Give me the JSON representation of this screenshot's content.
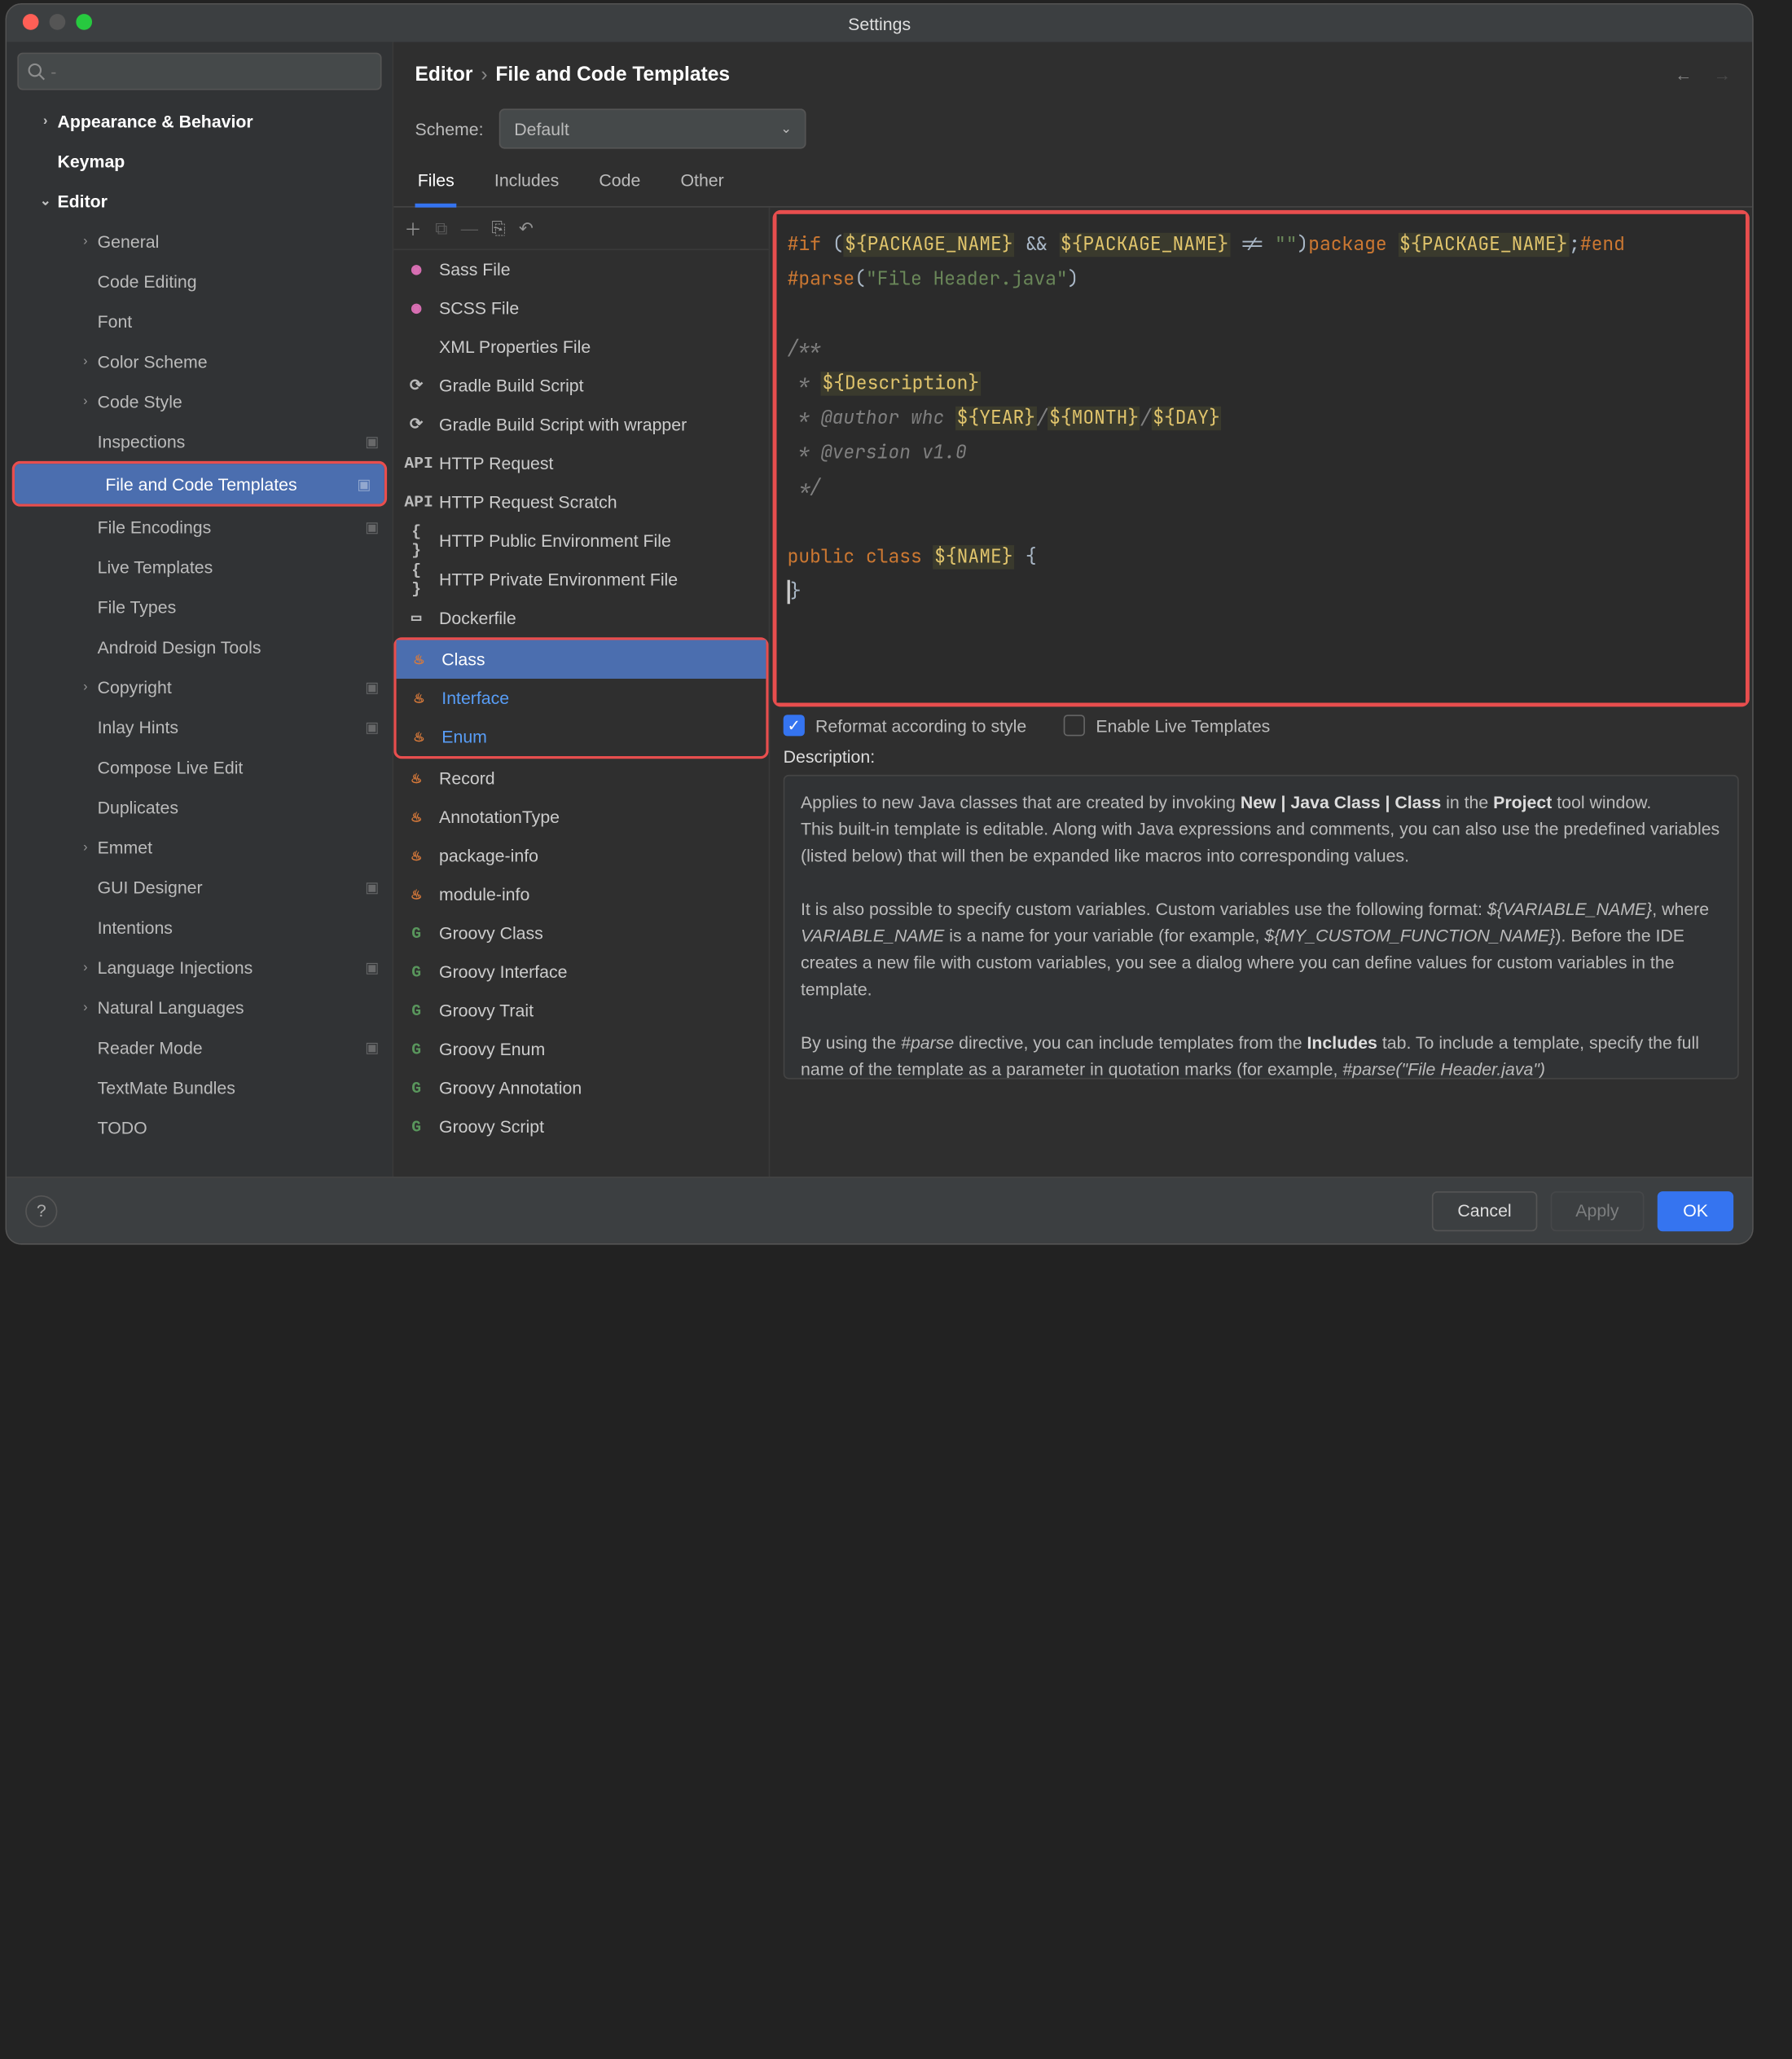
{
  "window_title": "Settings",
  "breadcrumb": {
    "root": "Editor",
    "page": "File and Code Templates"
  },
  "searchPlaceholder": "",
  "sidebar": {
    "appearance": "Appearance & Behavior",
    "keymap": "Keymap",
    "editor": "Editor",
    "items": [
      {
        "label": "General",
        "chev": true
      },
      {
        "label": "Code Editing"
      },
      {
        "label": "Font"
      },
      {
        "label": "Color Scheme",
        "chev": true
      },
      {
        "label": "Code Style",
        "chev": true
      },
      {
        "label": "Inspections",
        "badge": true
      },
      {
        "label": "File and Code Templates",
        "selected": true,
        "badge": true
      },
      {
        "label": "File Encodings",
        "badge": true
      },
      {
        "label": "Live Templates"
      },
      {
        "label": "File Types"
      },
      {
        "label": "Android Design Tools"
      },
      {
        "label": "Copyright",
        "chev": true,
        "badge": true
      },
      {
        "label": "Inlay Hints",
        "badge": true
      },
      {
        "label": "Compose Live Edit"
      },
      {
        "label": "Duplicates"
      },
      {
        "label": "Emmet",
        "chev": true
      },
      {
        "label": "GUI Designer",
        "badge": true
      },
      {
        "label": "Intentions"
      },
      {
        "label": "Language Injections",
        "chev": true,
        "badge": true
      },
      {
        "label": "Natural Languages",
        "chev": true
      },
      {
        "label": "Reader Mode",
        "badge": true
      },
      {
        "label": "TextMate Bundles"
      },
      {
        "label": "TODO"
      }
    ]
  },
  "scheme": {
    "label": "Scheme:",
    "value": "Default"
  },
  "tabs": [
    "Files",
    "Includes",
    "Code",
    "Other"
  ],
  "activeTab": 0,
  "templates": [
    {
      "label": "Sass File",
      "ico": "pink"
    },
    {
      "label": "SCSS File",
      "ico": "pink"
    },
    {
      "label": "XML Properties File",
      "ico": "xml"
    },
    {
      "label": "Gradle Build Script",
      "ico": "gradle"
    },
    {
      "label": "Gradle Build Script with wrapper",
      "ico": "gradle"
    },
    {
      "label": "HTTP Request",
      "ico": "api"
    },
    {
      "label": "HTTP Request Scratch",
      "ico": "api"
    },
    {
      "label": "HTTP Public Environment File",
      "ico": "braces"
    },
    {
      "label": "HTTP Private Environment File",
      "ico": "braces"
    },
    {
      "label": "Dockerfile",
      "ico": "docker"
    },
    {
      "label": "Class",
      "ico": "java",
      "selected": true,
      "link": true,
      "hlStart": true
    },
    {
      "label": "Interface",
      "ico": "java",
      "link": true
    },
    {
      "label": "Enum",
      "ico": "java",
      "link": true,
      "hlEnd": true
    },
    {
      "label": "Record",
      "ico": "java"
    },
    {
      "label": "AnnotationType",
      "ico": "java"
    },
    {
      "label": "package-info",
      "ico": "java"
    },
    {
      "label": "module-info",
      "ico": "java"
    },
    {
      "label": "Groovy Class",
      "ico": "green"
    },
    {
      "label": "Groovy Interface",
      "ico": "green"
    },
    {
      "label": "Groovy Trait",
      "ico": "green"
    },
    {
      "label": "Groovy Enum",
      "ico": "green"
    },
    {
      "label": "Groovy Annotation",
      "ico": "green"
    },
    {
      "label": "Groovy Script",
      "ico": "green"
    }
  ],
  "editor": {
    "tokens": [
      [
        "kw",
        "#if "
      ],
      [
        "",
        "("
      ],
      [
        "pv",
        "${PACKAGE_NAME}"
      ],
      [
        "",
        " && "
      ],
      [
        "pv",
        "${PACKAGE_NAME}"
      ],
      [
        "",
        " != "
      ],
      [
        "str",
        "\"\""
      ],
      [
        "",
        ")"
      ],
      [
        "kw",
        "package "
      ],
      [
        "pv",
        "${PACKAGE_NAME}"
      ],
      [
        "",
        ";"
      ],
      [
        "kw",
        "#end"
      ],
      [
        "nl",
        ""
      ],
      [
        "kw",
        "#parse"
      ],
      [
        "",
        "("
      ],
      [
        "str",
        "\"File Header.java\""
      ],
      [
        "",
        ")"
      ],
      [
        "nl",
        ""
      ],
      [
        "nl",
        ""
      ],
      [
        "cm",
        "/**"
      ],
      [
        "nl",
        ""
      ],
      [
        "cm",
        " * "
      ],
      [
        "pv",
        "${Description}"
      ],
      [
        "nl",
        ""
      ],
      [
        "cm",
        " * @author "
      ],
      [
        "cm",
        "whc "
      ],
      [
        "pv",
        "${YEAR}"
      ],
      [
        "cm",
        "/"
      ],
      [
        "pv",
        "${MONTH}"
      ],
      [
        "cm",
        "/"
      ],
      [
        "pv",
        "${DAY}"
      ],
      [
        "nl",
        ""
      ],
      [
        "cm",
        " * @version "
      ],
      [
        "cm",
        "v1.0"
      ],
      [
        "nl",
        ""
      ],
      [
        "cm",
        " */"
      ],
      [
        "nl",
        ""
      ],
      [
        "nl",
        ""
      ],
      [
        "kw",
        "public class "
      ],
      [
        "pv",
        "${NAME}"
      ],
      [
        "",
        " {"
      ],
      [
        "nl",
        ""
      ],
      [
        "curs",
        ""
      ],
      [
        "",
        "}"
      ]
    ]
  },
  "options": {
    "reformat": "Reformat according to style",
    "liveTpl": "Enable Live Templates"
  },
  "descHead": "Description:",
  "desc": {
    "p1a": "Applies to new Java classes that are created by invoking ",
    "p1b": "New | Java Class | Class",
    "p1c": " in the ",
    "p1d": "Project",
    "p1e": " tool window.",
    "p2": "This built-in template is editable. Along with Java expressions and comments, you can also use the predefined variables (listed below) that will then be expanded like macros into corresponding values.",
    "p3a": "It is also possible to specify custom variables. Custom variables use the following format: ",
    "p3b": "${VARIABLE_NAME}",
    "p3c": ", where ",
    "p3d": "VARIABLE_NAME",
    "p3e": " is a name for your variable (for example, ",
    "p3f": "${MY_CUSTOM_FUNCTION_NAME}",
    "p3g": "). Before the IDE creates a new file with custom variables, you see a dialog where you can define values for custom variables in the template.",
    "p4a": "By using the ",
    "p4b": "#parse",
    "p4c": " directive, you can include templates from the ",
    "p4d": "Includes",
    "p4e": " tab. To include a template, specify the full name of the template as a parameter in quotation marks (for example, ",
    "p4f": "#parse(\"File Header.java\")"
  },
  "buttons": {
    "cancel": "Cancel",
    "apply": "Apply",
    "ok": "OK"
  }
}
